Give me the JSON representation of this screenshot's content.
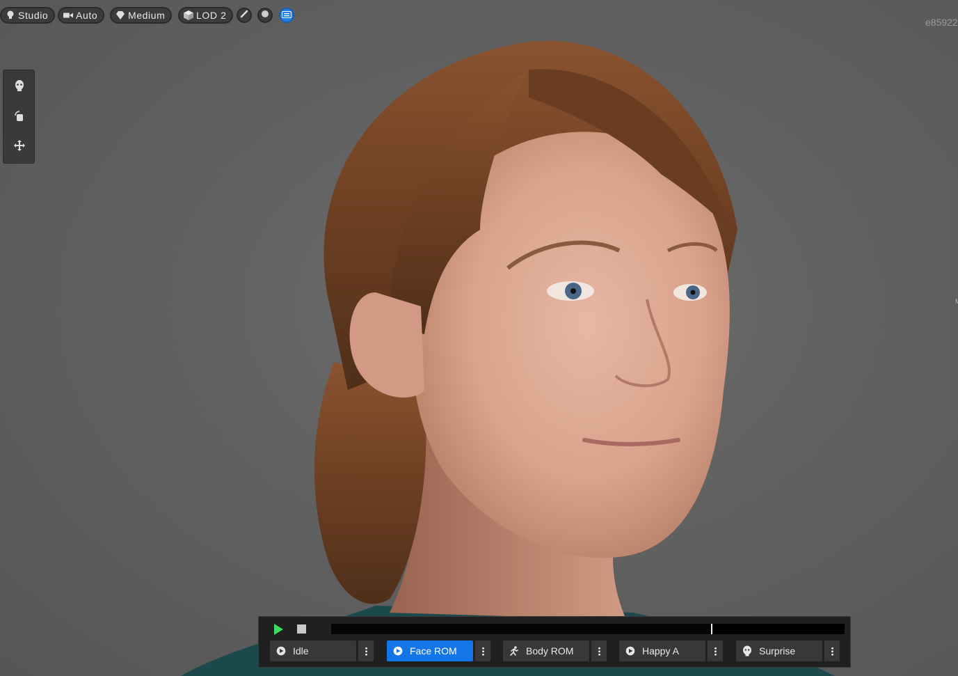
{
  "toolbar": {
    "environment_label": "Studio",
    "camera_label": "Auto",
    "quality_label": "Medium",
    "lod_label": "LOD 2"
  },
  "viewport": {
    "id_text": "e85922",
    "edge_label": "M"
  },
  "animation": {
    "playback_progress": 0.74,
    "items": [
      {
        "label": "Idle",
        "icon": "play-circle-icon",
        "selected": false
      },
      {
        "label": "Face ROM",
        "icon": "play-circle-icon",
        "selected": true
      },
      {
        "label": "Body ROM",
        "icon": "running-person-icon",
        "selected": false
      },
      {
        "label": "Happy A",
        "icon": "play-circle-icon",
        "selected": false
      },
      {
        "label": "Surprise",
        "icon": "face-icon",
        "selected": false
      }
    ]
  },
  "colors": {
    "accent": "#1276e8",
    "play": "#3ddc5f",
    "background": "#626262"
  }
}
